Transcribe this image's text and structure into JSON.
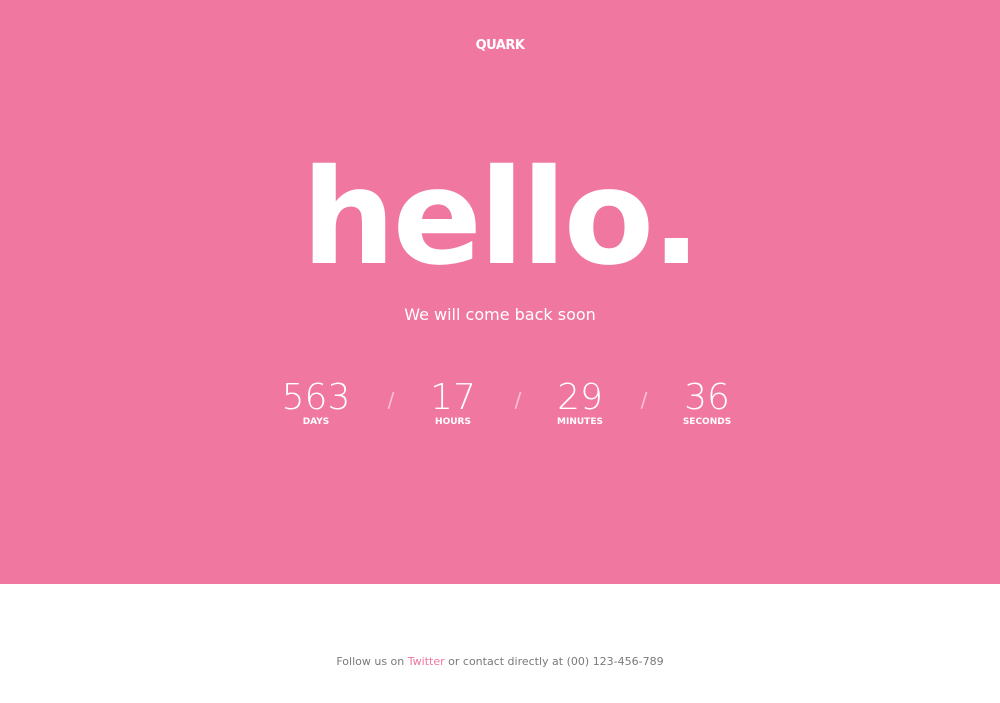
{
  "header": {
    "logo_text": "QUARK"
  },
  "hero": {
    "headline": "hello.",
    "subtitle": "We will come back soon"
  },
  "countdown": {
    "separator": "/",
    "units": [
      {
        "value": "563",
        "label": "DAYS"
      },
      {
        "value": "17",
        "label": "HOURS"
      },
      {
        "value": "29",
        "label": "MINUTES"
      },
      {
        "value": "36",
        "label": "SECONDS"
      }
    ]
  },
  "footer": {
    "prefix": "Follow us on",
    "twitter_link": "Twitter",
    "suffix": "or contact directly at (00) 123-456-789"
  },
  "colors": {
    "brand_pink": "#f077a0",
    "footer_background": "#ffffff",
    "footer_text": "#7a7a7a"
  }
}
